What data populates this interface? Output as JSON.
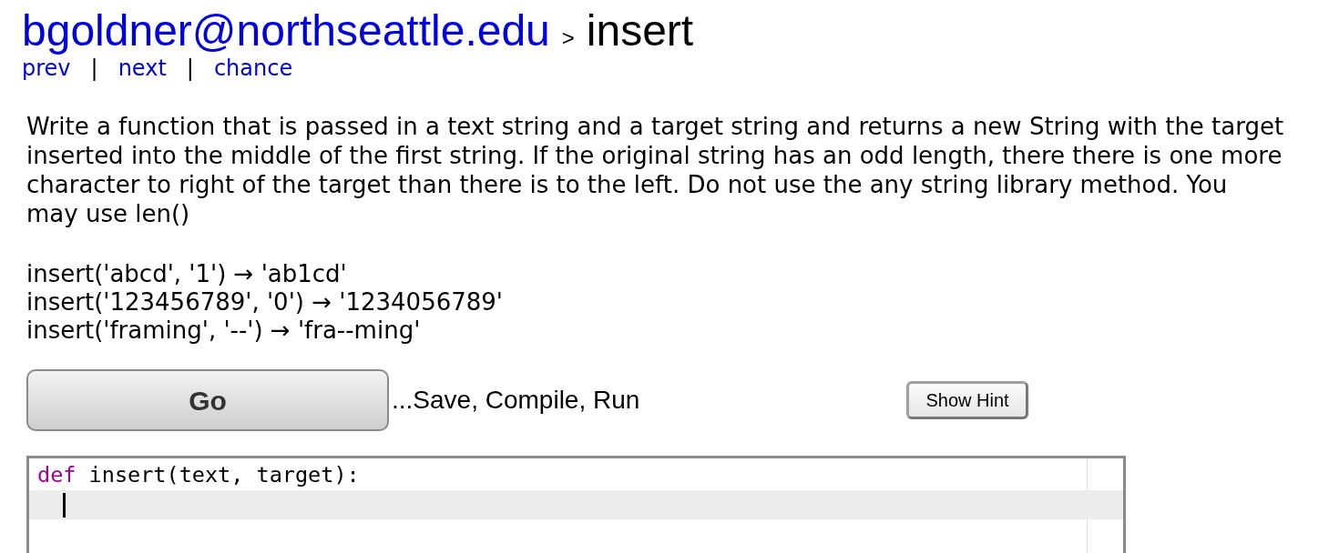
{
  "header": {
    "user_link": "bgoldner@northseattle.edu",
    "separator": ">",
    "title": "insert"
  },
  "nav": [
    {
      "kind": "link",
      "text": "prev"
    },
    {
      "kind": "separator",
      "text": "|"
    },
    {
      "kind": "link",
      "text": "next"
    },
    {
      "kind": "separator",
      "text": "|"
    },
    {
      "kind": "link",
      "text": "chance"
    }
  ],
  "problem": {
    "description": "Write a function that is passed in a text string and a target string and returns a new String with the target inserted into the middle of the first string. If the original string has an odd length, there there is one more character to right of the target than there is to the left. Do not use the any string library method. You may use len()",
    "examples": [
      "insert('abcd', '1') → 'ab1cd'",
      "insert('123456789', '0') → '1234056789'",
      "insert('framing', '--') → 'fra--ming'"
    ]
  },
  "actions": {
    "go_button": "Go",
    "go_note": "...Save, Compile, Run",
    "hint_button": "Show Hint"
  },
  "editor": {
    "lines": [
      {
        "keyword": "def",
        "code": " insert(text, target):",
        "active": false
      },
      {
        "active": true
      }
    ]
  }
}
